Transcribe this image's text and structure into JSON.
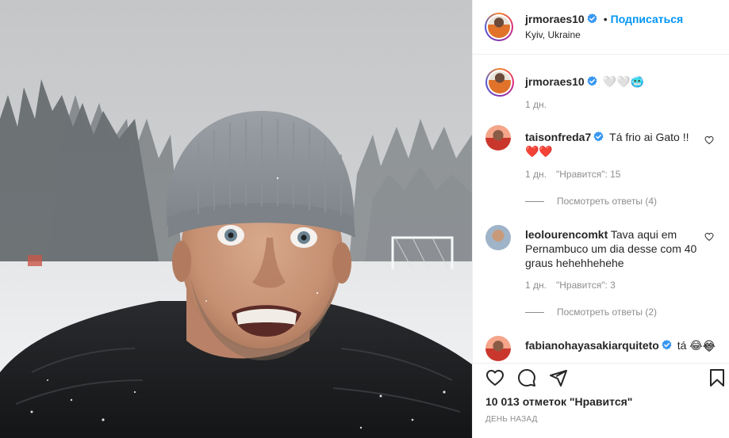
{
  "post": {
    "author": "jrmoraes10",
    "follow_label": "Подписаться",
    "separator": "•",
    "location": "Kyiv, Ukraine"
  },
  "caption": {
    "author": "jrmoraes10",
    "text": "🤍🤍🥶",
    "time": "1 дн."
  },
  "comments": [
    {
      "author": "taisonfreda7",
      "text": "Tá frio ai Gato !! ❤️❤️",
      "time": "1 дн.",
      "likes": "\"Нравится\": 15",
      "replies": "Посмотреть ответы (4)"
    },
    {
      "author": "leolourencomkt",
      "text": "Tava aqui em Pernambuco um dia desse com 40 graus hehehhehehe",
      "time": "1 дн.",
      "likes": "\"Нравится\": 3",
      "replies": "Посмотреть ответы (2)"
    },
    {
      "author": "fabianohayasakiarquiteto",
      "text": "tá 😂😂"
    }
  ],
  "actions": {
    "likes_count": "10 013 отметок \"Нравится\"",
    "date": "День назад"
  },
  "colors": {
    "accent": "#0095f6",
    "verified": "#3897f0",
    "heart_red": "#ed4956",
    "muted": "#8e8e8e"
  },
  "icons": [
    "verified-badge-icon",
    "heart-icon",
    "comment-icon",
    "share-icon",
    "bookmark-icon"
  ]
}
